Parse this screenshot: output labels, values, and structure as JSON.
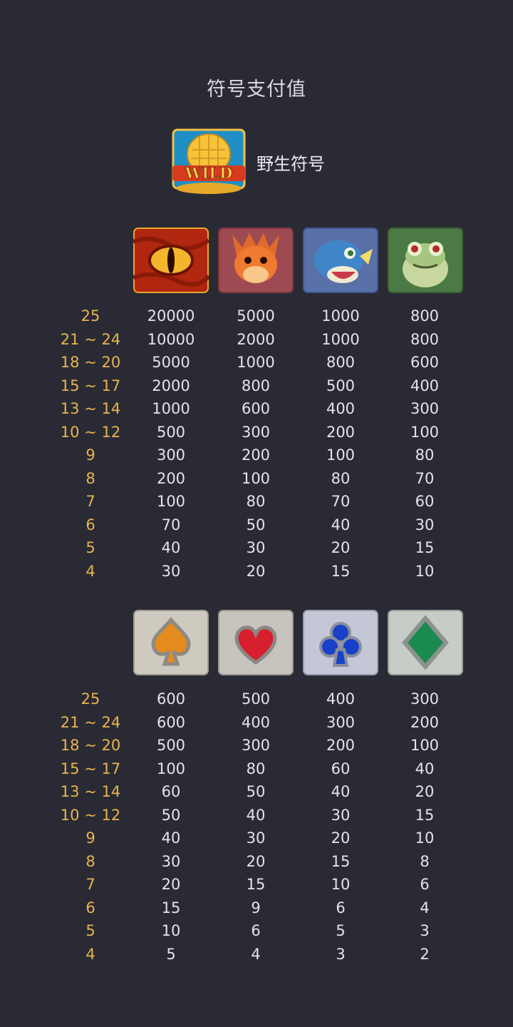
{
  "title": "符号支付值",
  "wild_label": "野生符号",
  "wild_icon_text": "WILD",
  "section1": {
    "icons": [
      "dragon-eye-icon",
      "red-dragon-icon",
      "blue-dinosaur-icon",
      "green-frog-icon"
    ],
    "rows": [
      {
        "count": "25",
        "values": [
          "20000",
          "5000",
          "1000",
          "800"
        ]
      },
      {
        "count": "21 ~ 24",
        "values": [
          "10000",
          "2000",
          "1000",
          "800"
        ]
      },
      {
        "count": "18 ~ 20",
        "values": [
          "5000",
          "1000",
          "800",
          "600"
        ]
      },
      {
        "count": "15 ~ 17",
        "values": [
          "2000",
          "800",
          "500",
          "400"
        ]
      },
      {
        "count": "13 ~ 14",
        "values": [
          "1000",
          "600",
          "400",
          "300"
        ]
      },
      {
        "count": "10 ~ 12",
        "values": [
          "500",
          "300",
          "200",
          "100"
        ]
      },
      {
        "count": "9",
        "values": [
          "300",
          "200",
          "100",
          "80"
        ]
      },
      {
        "count": "8",
        "values": [
          "200",
          "100",
          "80",
          "70"
        ]
      },
      {
        "count": "7",
        "values": [
          "100",
          "80",
          "70",
          "60"
        ]
      },
      {
        "count": "6",
        "values": [
          "70",
          "50",
          "40",
          "30"
        ]
      },
      {
        "count": "5",
        "values": [
          "40",
          "30",
          "20",
          "15"
        ]
      },
      {
        "count": "4",
        "values": [
          "30",
          "20",
          "15",
          "10"
        ]
      }
    ]
  },
  "section2": {
    "icons": [
      "spade-icon",
      "heart-icon",
      "club-icon",
      "diamond-icon"
    ],
    "rows": [
      {
        "count": "25",
        "values": [
          "600",
          "500",
          "400",
          "300"
        ]
      },
      {
        "count": "21 ~ 24",
        "values": [
          "600",
          "400",
          "300",
          "200"
        ]
      },
      {
        "count": "18 ~ 20",
        "values": [
          "500",
          "300",
          "200",
          "100"
        ]
      },
      {
        "count": "15 ~ 17",
        "values": [
          "100",
          "80",
          "60",
          "40"
        ]
      },
      {
        "count": "13 ~ 14",
        "values": [
          "60",
          "50",
          "40",
          "20"
        ]
      },
      {
        "count": "10 ~ 12",
        "values": [
          "50",
          "40",
          "30",
          "15"
        ]
      },
      {
        "count": "9",
        "values": [
          "40",
          "30",
          "20",
          "10"
        ]
      },
      {
        "count": "8",
        "values": [
          "30",
          "20",
          "15",
          "8"
        ]
      },
      {
        "count": "7",
        "values": [
          "20",
          "15",
          "10",
          "6"
        ]
      },
      {
        "count": "6",
        "values": [
          "15",
          "9",
          "6",
          "4"
        ]
      },
      {
        "count": "5",
        "values": [
          "10",
          "6",
          "5",
          "3"
        ]
      },
      {
        "count": "4",
        "values": [
          "5",
          "4",
          "3",
          "2"
        ]
      }
    ]
  },
  "colors": {
    "background": "#2a2a35",
    "count_text": "#e8b54d",
    "value_text": "#e4e4e8"
  }
}
